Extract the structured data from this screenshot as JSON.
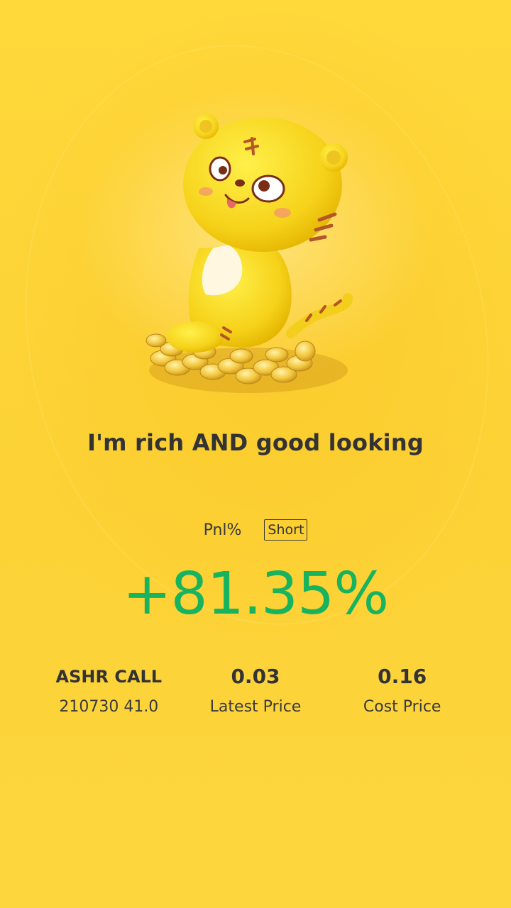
{
  "slogan": "I'm rich AND good looking",
  "pnl": {
    "label": "Pnl%",
    "direction_tag": "Short",
    "value": "+81.35%",
    "value_color": "#18B35E"
  },
  "position": {
    "symbol": "ASHR CALL",
    "contract": "210730 41.0",
    "latest_price": "0.03",
    "latest_price_label": "Latest Price",
    "cost_price": "0.16",
    "cost_price_label": "Cost Price"
  },
  "colors": {
    "background": "#FCD539",
    "text": "#333333",
    "profit": "#18B35E"
  },
  "mascot": {
    "icon": "tiger-mascot-on-coins-icon"
  }
}
